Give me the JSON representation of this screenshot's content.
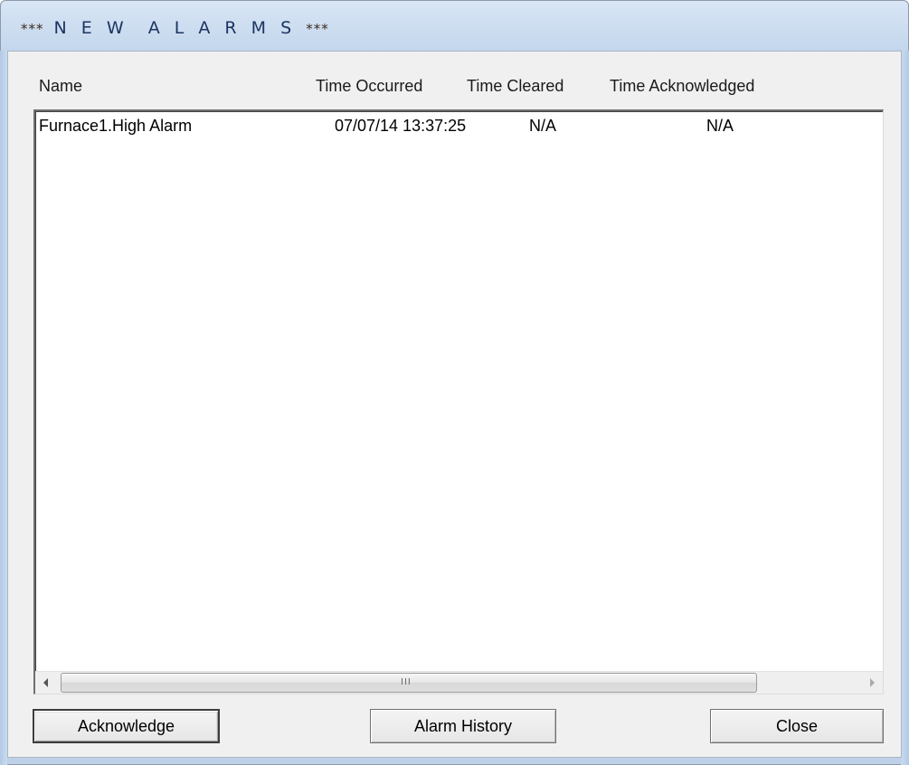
{
  "window": {
    "title_prefix": "***",
    "title_main": "N E W  A L A R M S",
    "title_suffix": "***"
  },
  "columns": {
    "name": "Name",
    "time_occurred": "Time Occurred",
    "time_cleared": "Time Cleared",
    "time_acknowledged": "Time Acknowledged"
  },
  "alarms": [
    {
      "name": "Furnace1.High Alarm",
      "time_occurred": "07/07/14 13:37:25",
      "time_cleared": "N/A",
      "time_acknowledged": "N/A"
    }
  ],
  "scrollbar": {
    "grip": "III",
    "left_icon": "arrow-left-icon",
    "right_icon": "arrow-right-icon"
  },
  "buttons": {
    "acknowledge": "Acknowledge",
    "alarm_history": "Alarm History",
    "close": "Close"
  }
}
